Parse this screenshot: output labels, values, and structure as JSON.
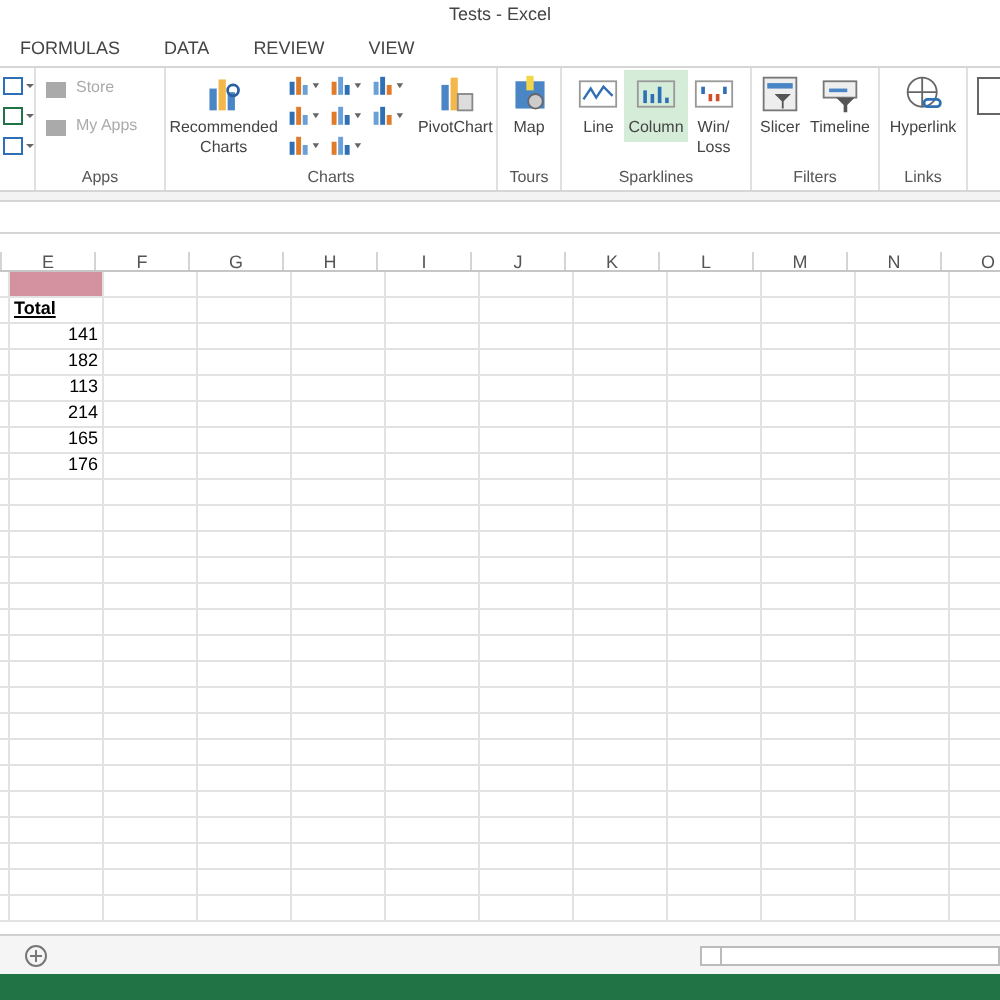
{
  "window": {
    "title": "Tests - Excel"
  },
  "ribbon_tabs": [
    {
      "label": "FORMULAS",
      "selected": false
    },
    {
      "label": "DATA",
      "selected": false
    },
    {
      "label": "REVIEW",
      "selected": false
    },
    {
      "label": "VIEW",
      "selected": false
    }
  ],
  "ribbon_groups": [
    {
      "label": "Apps",
      "buttons": [
        {
          "kind": "small",
          "label": "Store",
          "disabled": true
        },
        {
          "kind": "small",
          "label": "My Apps",
          "disabled": true
        }
      ]
    },
    {
      "label": "Charts",
      "buttons": [
        {
          "kind": "large",
          "label": "Recommended Charts"
        },
        {
          "kind": "chart-grid"
        },
        {
          "kind": "large",
          "label": "PivotChart"
        }
      ]
    },
    {
      "label": "Tours",
      "buttons": [
        {
          "kind": "large",
          "label": "Map"
        }
      ]
    },
    {
      "label": "Sparklines",
      "buttons": [
        {
          "kind": "large",
          "label": "Line",
          "selected": false
        },
        {
          "kind": "large",
          "label": "Column",
          "selected": true
        },
        {
          "kind": "large",
          "label": "Win/ Loss",
          "selected": false
        }
      ]
    },
    {
      "label": "Filters",
      "buttons": [
        {
          "kind": "large",
          "label": "Slicer"
        },
        {
          "kind": "large",
          "label": "Timeline"
        }
      ]
    },
    {
      "label": "Links",
      "buttons": [
        {
          "kind": "large",
          "label": "Hyperlink"
        }
      ]
    }
  ],
  "sheet": {
    "columns": [
      "E",
      "F",
      "G",
      "H",
      "I",
      "J",
      "K",
      "L",
      "M",
      "N",
      "O"
    ],
    "cells_e": [
      {
        "kind": "highlight"
      },
      {
        "kind": "header",
        "text": "Total"
      },
      {
        "kind": "number",
        "text": "141"
      },
      {
        "kind": "number",
        "text": "182"
      },
      {
        "kind": "number",
        "text": "113"
      },
      {
        "kind": "number",
        "text": "214"
      },
      {
        "kind": "number",
        "text": "165"
      },
      {
        "kind": "number",
        "text": "176"
      }
    ]
  }
}
